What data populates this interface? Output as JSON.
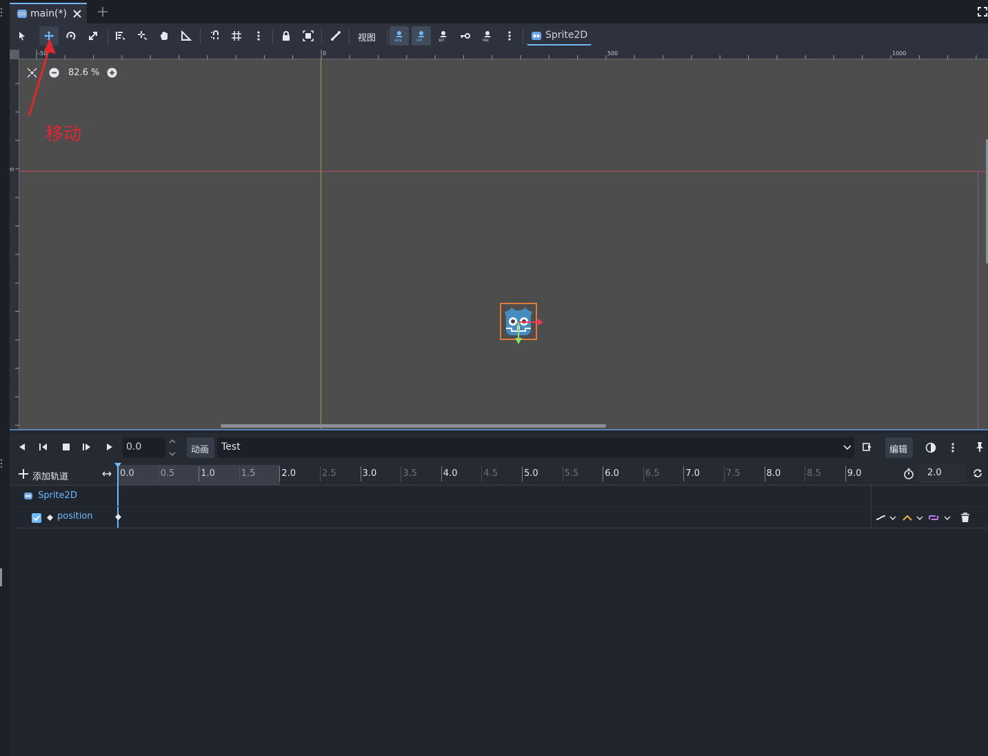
{
  "tab": {
    "title": "main(*)",
    "close_icon": "close-icon",
    "add_icon": "plus-icon"
  },
  "toolbar": {
    "view_label": "视图",
    "node_label": "Sprite2D"
  },
  "viewport": {
    "zoom": "82.6 %",
    "ruler_top": [
      "-50",
      "0",
      "500",
      "1000"
    ],
    "ruler_left": [
      "0"
    ],
    "annotation": "移动",
    "annotation_color": "#e0282e"
  },
  "anim": {
    "time_value": "0.0",
    "anim_label": "动画",
    "anim_name": "Test",
    "edit_label": "编辑",
    "add_track_label": "添加轨道",
    "ticks": [
      "0.0",
      "0.5",
      "1.0",
      "1.5",
      "2.0",
      "2.5",
      "3.0",
      "3.5",
      "4.0",
      "4.5",
      "5.0",
      "5.5",
      "6.0",
      "6.5",
      "7.0",
      "7.5",
      "8.0",
      "8.5",
      "9.0"
    ],
    "length": "2.0",
    "node_name": "Sprite2D",
    "track_name": "position"
  },
  "colors": {
    "accent": "#70bafa",
    "canvas": "#4d4d4d",
    "panel": "#21252e"
  }
}
